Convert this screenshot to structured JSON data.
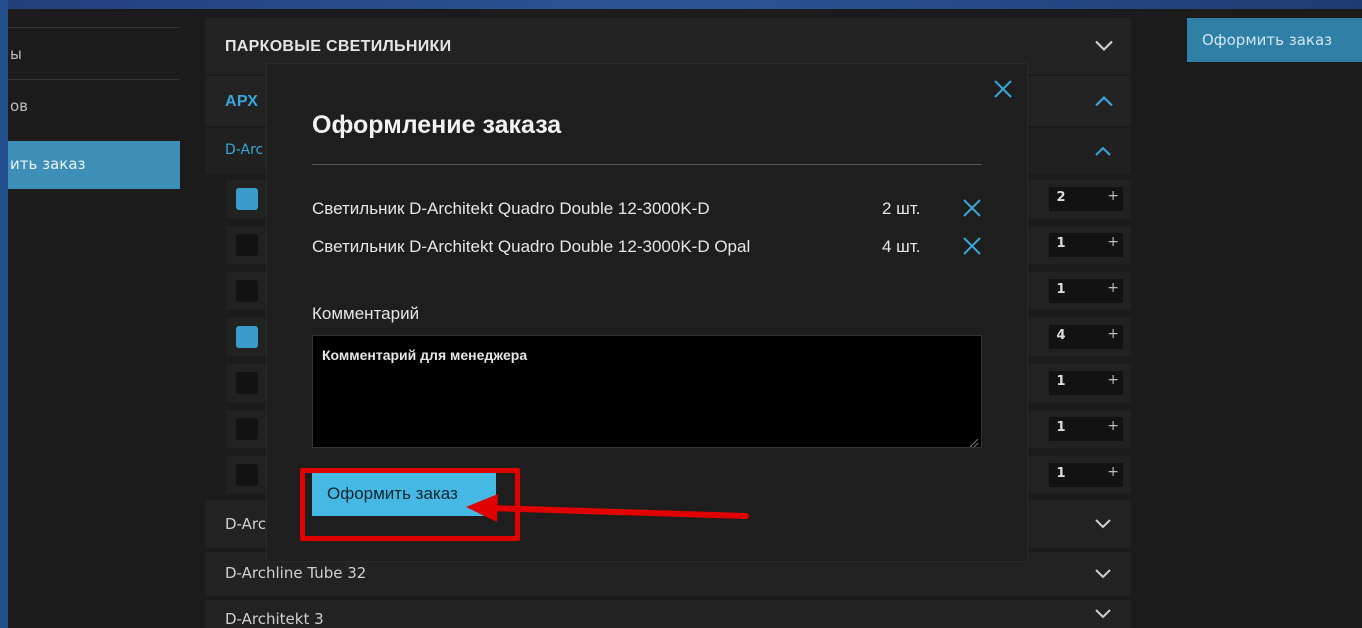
{
  "sidebar": {
    "items": [
      {
        "label": "ы"
      },
      {
        "label": "ов"
      }
    ],
    "active_label": "ить заказ"
  },
  "header_button": {
    "label": "Оформить заказ"
  },
  "accordions": {
    "parks": {
      "title": "ПАРКОВЫЕ СВЕТИЛЬНИКИ"
    },
    "arch": {
      "title": "АРХ"
    },
    "darc": {
      "title": "D-Arc"
    },
    "darc2": {
      "title": "D-Arc"
    },
    "tube": {
      "title": "D-Archline Tube 32"
    },
    "d3": {
      "title": "D-Architekt 3"
    }
  },
  "rows": [
    {
      "checked": true,
      "qty": "2"
    },
    {
      "checked": false,
      "qty": "1"
    },
    {
      "checked": false,
      "qty": "1"
    },
    {
      "checked": true,
      "qty": "4"
    },
    {
      "checked": false,
      "qty": "1"
    },
    {
      "checked": false,
      "qty": "1"
    },
    {
      "checked": false,
      "qty": "1"
    }
  ],
  "qty_plus": "+",
  "modal": {
    "title": "Оформление заказа",
    "items": [
      {
        "name": "Светильник D-Architekt Quadro Double 12-3000K-D",
        "qty": "2 шт."
      },
      {
        "name": "Светильник D-Architekt Quadro Double 12-3000K-D Opal",
        "qty": "4 шт."
      }
    ],
    "comment_label": "Комментарий",
    "comment_value": "Комментарий для менеджера",
    "submit_label": "Оформить заказ"
  },
  "colors": {
    "accent": "#45b9e4",
    "highlight": "#e10000",
    "checkbox_on": "#3a9ccb"
  }
}
